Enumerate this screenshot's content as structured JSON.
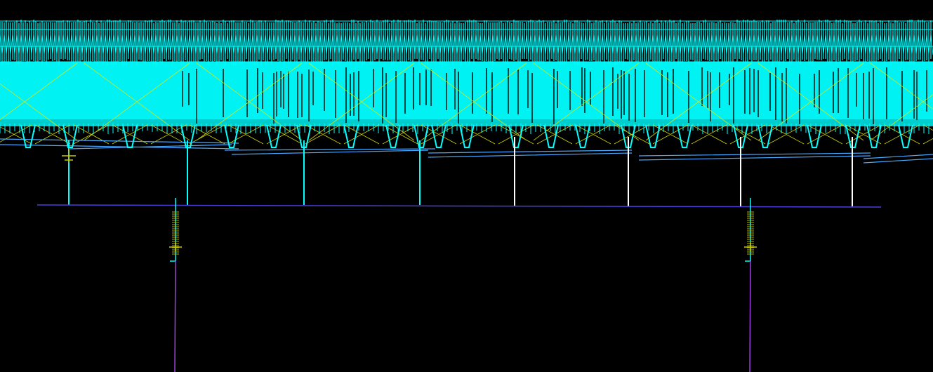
{
  "drawing": {
    "background": "#000000",
    "colors": {
      "truss_members": "#00ffff",
      "truss_fill": "#00f2f2",
      "diagonal_bracing": "#e8e800",
      "chord_lines": "#4aa8ff",
      "selected_columns": "#ffffff",
      "ground_line": "#4b3fd6",
      "pile_lines": "#a040e0",
      "pile_hatch": "#b0b000",
      "pile_marker": "#c8c800"
    },
    "entities": {
      "column_count": 8,
      "pile_count": 2
    }
  }
}
